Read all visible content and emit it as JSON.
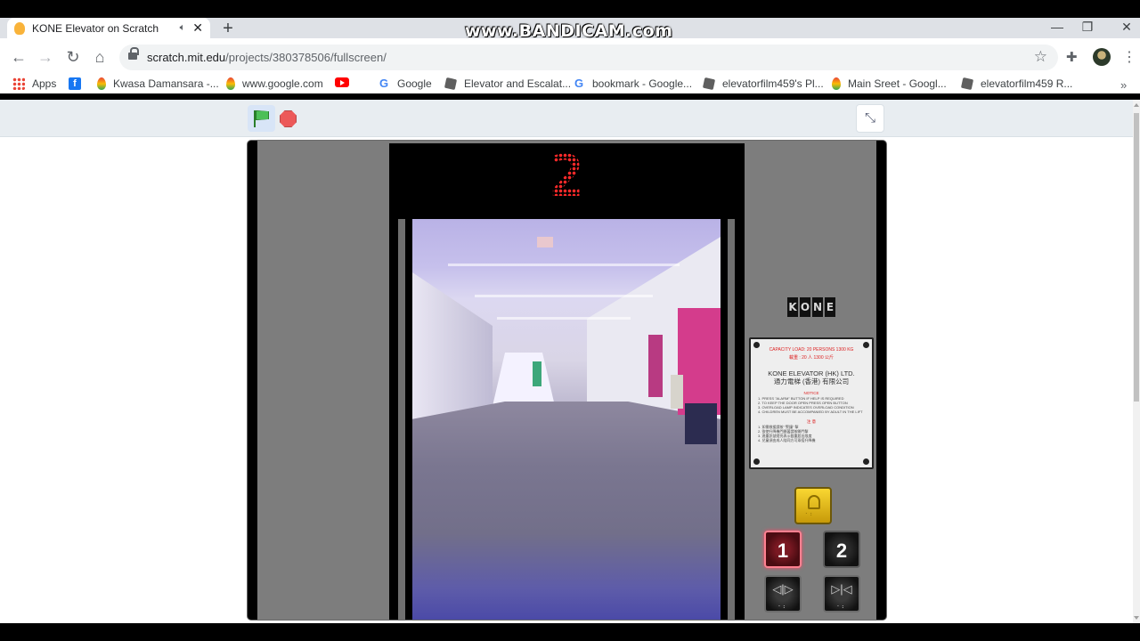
{
  "recorder": {
    "watermark": "www.BANDICAM.com"
  },
  "browser": {
    "tab": {
      "title": "KONE Elevator on Scratch",
      "audio_icon": "speaker-icon",
      "close_glyph": "✕"
    },
    "new_tab_glyph": "+",
    "window_controls": {
      "minimize": "—",
      "maximize": "❐",
      "close": "✕"
    },
    "nav": {
      "back": "←",
      "forward": "→",
      "reload": "↻",
      "home": "⌂"
    },
    "address": {
      "host": "scratch.mit.edu",
      "path": "/projects/380378506/fullscreen/"
    },
    "star_glyph": "☆",
    "extensions_glyph": "✚",
    "menu_glyph": "⋮",
    "bookmarks": [
      {
        "label": "Apps",
        "icon": "apps-icon"
      },
      {
        "label": "",
        "icon": "facebook-icon"
      },
      {
        "label": "Kwasa Damansara -...",
        "icon": "maps-pin-icon"
      },
      {
        "label": "www.google.com",
        "icon": "maps-pin-icon"
      },
      {
        "label": "",
        "icon": "youtube-icon"
      },
      {
        "label": "Google",
        "icon": "google-icon"
      },
      {
        "label": "Elevator and Escalat...",
        "icon": "roblox-icon"
      },
      {
        "label": "bookmark - Google...",
        "icon": "google-icon"
      },
      {
        "label": "elevatorfilm459's Pl...",
        "icon": "roblox-icon"
      },
      {
        "label": "Main Sreet - Googl...",
        "icon": "maps-pin-icon"
      },
      {
        "label": "elevatorfilm459 R...",
        "icon": "roblox-icon"
      }
    ],
    "bookmarks_more": "»"
  },
  "scratch": {
    "green_flag_icon": "green-flag-icon",
    "stop_icon": "stop-sign-icon",
    "exit_fullscreen_glyph": "⤡"
  },
  "elevator": {
    "floor_indicator": "2",
    "brand_letters": [
      "K",
      "O",
      "N",
      "E"
    ],
    "plate": {
      "capacity": "CAPACITY LOAD: 20 PERSONS 1300 KG",
      "capacity_cn": "載重 : 20 人 1300 公斤",
      "company_en": "KONE ELEVATOR (HK) LTD.",
      "company_cn": "通力電梯 (香港) 有限公司",
      "notice_heading": "NOTICE",
      "notices": [
        "1. PRESS \"ALARM\" BUTTON IF HELP IS REQUIRED",
        "2. TO KEEP THE DOOR OPEN PRESS OPEN BUTTON",
        "3. OVERLOAD LAMP INDICATES OVERLOAD CONDITION",
        "4. CHILDREN MUST BE ACCOMPANIED BY ADULT IN THE LIFT"
      ],
      "notice_cn_heading": "注 意",
      "notices_cn": [
        "1. 如需救援請按 \"警鐘\" 掣",
        "2. 欲使升降機門開著請按開門掣",
        "3. 過重訊號燈亮表示載重超出限度",
        "4. 兒童須由成人陪同方可乘搭升降機"
      ]
    },
    "buttons": {
      "floor_1": "1",
      "floor_2": "2",
      "open": "◁|▷",
      "close": "▷|◁",
      "braille": "⠁⠃"
    },
    "lit_button_color": "#ff4b6a",
    "display_color": "#ff2a2a"
  }
}
